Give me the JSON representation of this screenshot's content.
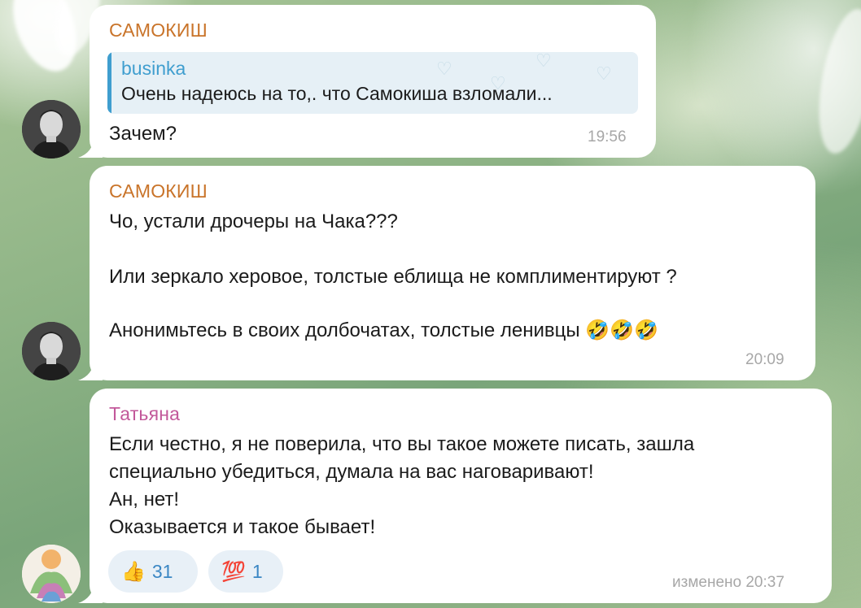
{
  "messages": [
    {
      "sender": "САМОКИШ",
      "reply": {
        "name": "businka",
        "text": "Очень надеюсь на то,. что Самокиша взломали..."
      },
      "lines": [
        "Зачем?"
      ],
      "time": "19:56"
    },
    {
      "sender": "САМОКИШ",
      "lines": [
        "Чо, устали дрочеры на Чака???",
        "Или зеркало херовое, толстые еблища не комплиментируют ?",
        "Анонимьтесь в своих долбочатах, толстые ленивцы 🤣🤣🤣"
      ],
      "time": "20:09"
    },
    {
      "sender": "Татьяна",
      "lines": [
        "Если честно, я не поверила, что вы такое можете писать, зашла",
        "специально убедиться, думала на вас наговаривают!",
        "Ан, нет!",
        "Оказывается и такое бывает!"
      ],
      "reactions": [
        {
          "emoji": "👍",
          "count": "31"
        },
        {
          "emoji": "💯",
          "count": "1"
        }
      ],
      "time": "изменено 20:37"
    }
  ],
  "colors": {
    "sender_samokish": "#c9742a",
    "sender_tatyana": "#c2589a",
    "reply_accent": "#3f9ecf",
    "reaction_count": "#3b87c4",
    "timestamp": "#a7a7a7"
  },
  "icons": [
    "avatar-samokish",
    "avatar-tatyana",
    "thumbs-up-icon",
    "hundred-points-icon",
    "rofl-emoji-icon"
  ]
}
